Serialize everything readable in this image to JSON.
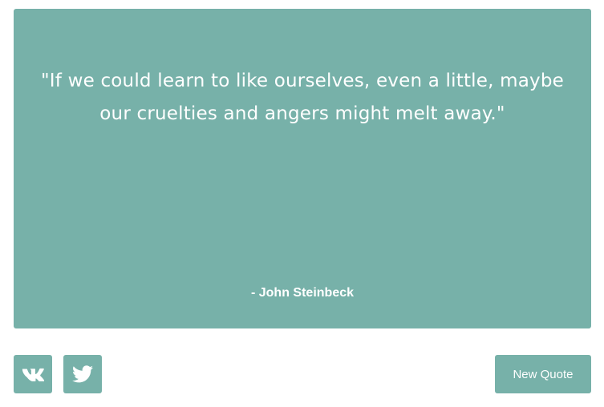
{
  "quote": {
    "text": "\"If we could learn to like ourselves, even a little, maybe our cruelties and angers might melt away.\"",
    "author": "- John Steinbeck"
  },
  "actions": {
    "vk_icon": "vk-icon",
    "twitter_icon": "twitter-icon",
    "new_quote_label": "New Quote"
  },
  "colors": {
    "accent": "#77b1a9",
    "text": "#ffffff",
    "background": "#ffffff"
  }
}
